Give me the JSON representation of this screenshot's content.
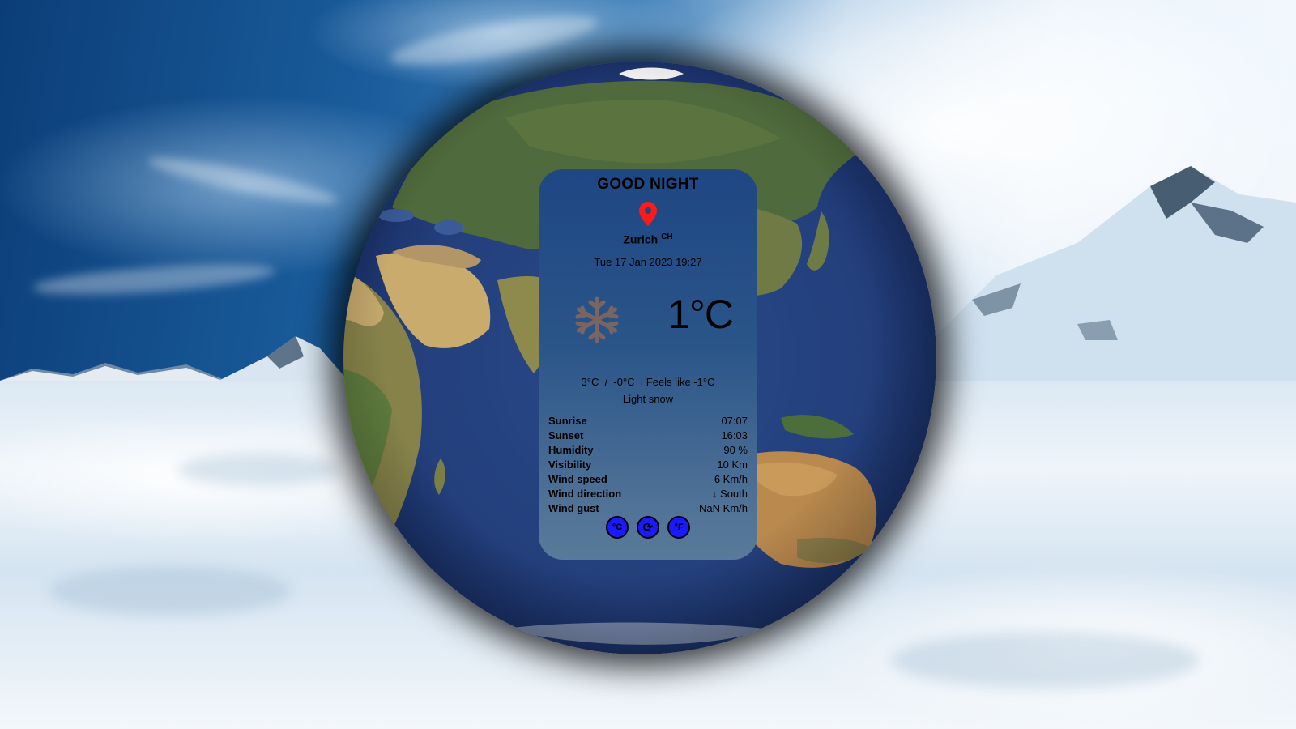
{
  "greeting": "GOOD NIGHT",
  "location": {
    "city": "Zurich",
    "country": "CH"
  },
  "datetime": "Tue 17 Jan 2023 19:27",
  "weather": {
    "icon": "snowflake-icon",
    "temperature": "1°C",
    "min_max_feels": "3°C  /  -0°C  | Feels like -1°C",
    "description": "Light snow"
  },
  "details": [
    {
      "label": "Sunrise",
      "value": "07:07"
    },
    {
      "label": "Sunset",
      "value": "16:03"
    },
    {
      "label": "Humidity",
      "value": "90 %"
    },
    {
      "label": "Visibility",
      "value": "10 Km"
    },
    {
      "label": "Wind speed",
      "value": "6 Km/h"
    },
    {
      "label": "Wind direction",
      "value": "↓ South"
    },
    {
      "label": "Wind gust",
      "value": "NaN Km/h"
    }
  ],
  "buttons": {
    "celsius": "°C",
    "refresh": "⟳",
    "fahrenheit": "°F"
  },
  "colors": {
    "pin": "#ff1a1a",
    "button_fill": "#1a1aff",
    "snowflake": "#7a6560",
    "card_top": "#1e4783",
    "card_bottom": "#587b99"
  }
}
